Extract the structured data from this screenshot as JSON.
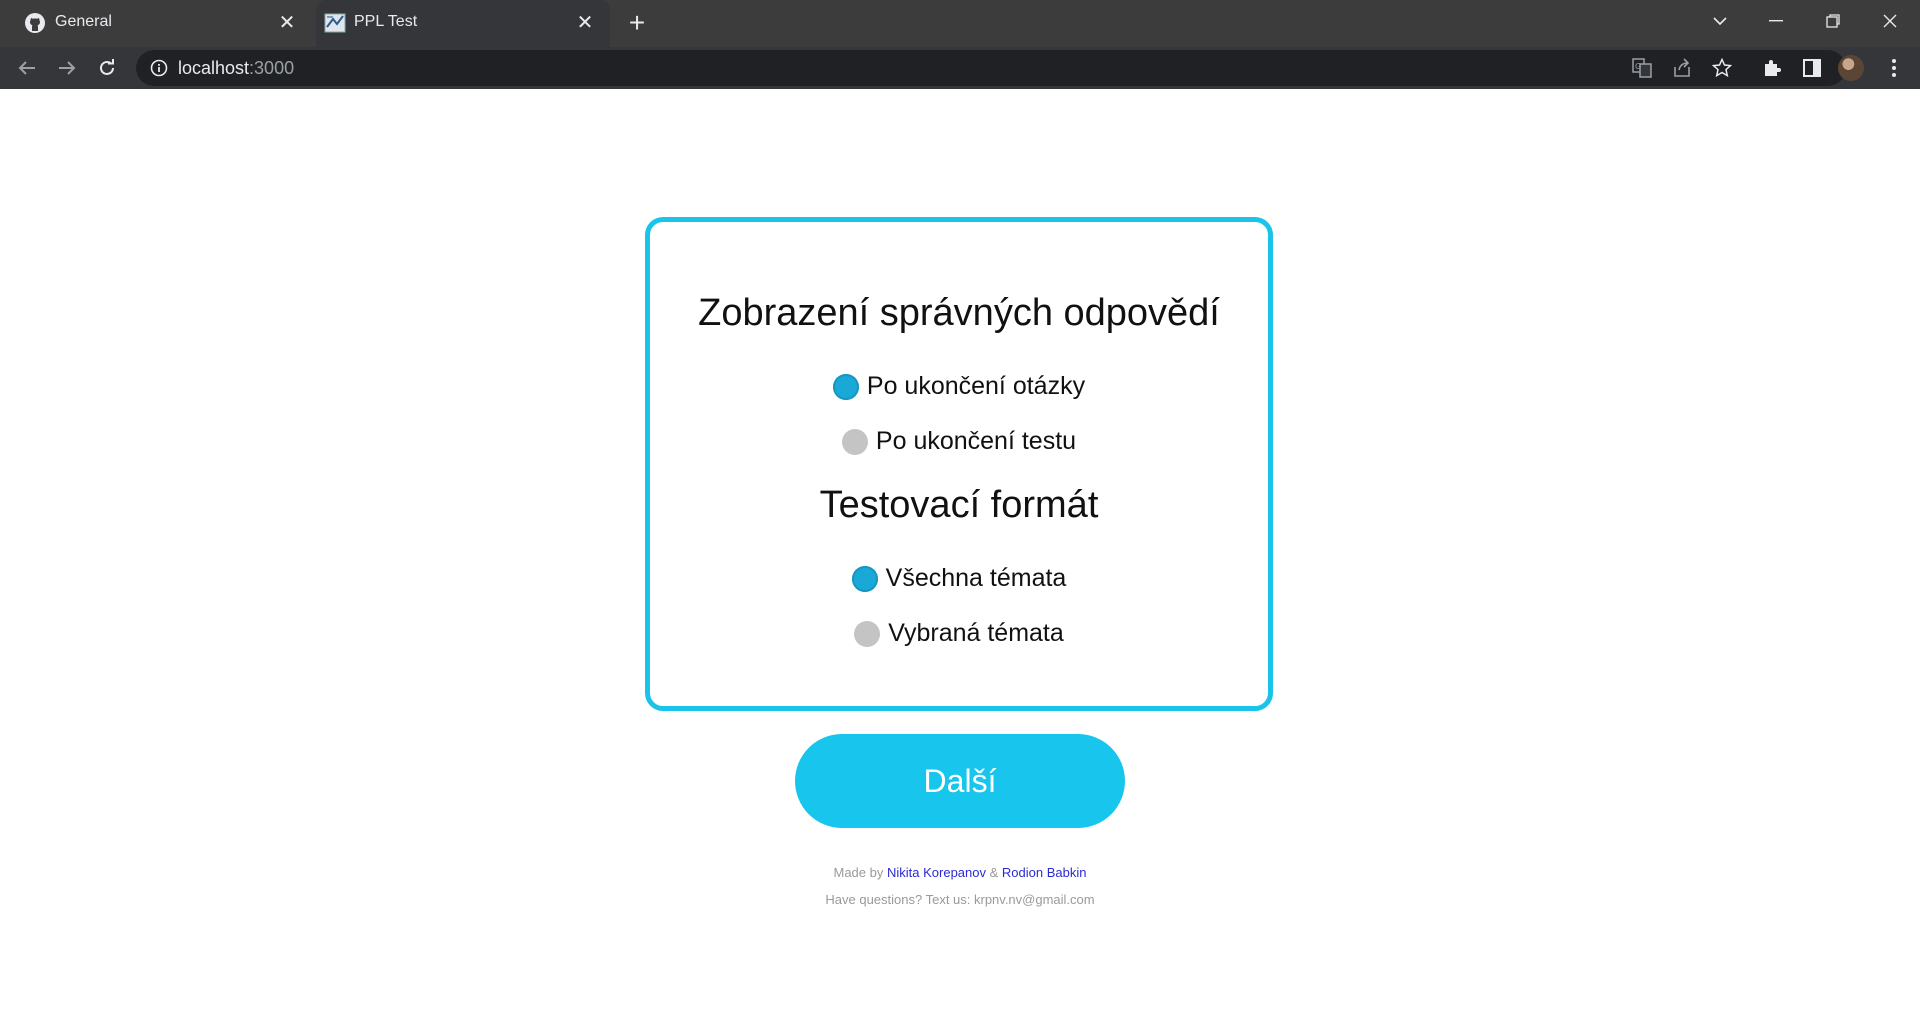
{
  "browser": {
    "tabs": [
      {
        "title": "General",
        "icon": "github-icon",
        "active": false
      },
      {
        "title": "PPL Test",
        "icon": "page-favicon",
        "active": true
      }
    ],
    "url_host": "localhost",
    "url_port": ":3000"
  },
  "settings": {
    "answers_title": "Zobrazení správných odpovědí",
    "answers_options": [
      {
        "label": "Po ukončení otázky",
        "selected": true
      },
      {
        "label": "Po ukončení testu",
        "selected": false
      }
    ],
    "format_title": "Testovací formát",
    "format_options": [
      {
        "label": "Všechna témata",
        "selected": true
      },
      {
        "label": "Vybraná témata",
        "selected": false
      }
    ]
  },
  "next_button_label": "Další",
  "footer": {
    "made_by": "Made by",
    "author1": "Nikita Korepanov",
    "amp": "&",
    "author2": "Rodion Babkin",
    "contact": "Have questions? Text us: krpnv.nv@gmail.com"
  },
  "colors": {
    "accent": "#18c5ec",
    "radio_selected": "#1aa9d6",
    "radio_unselected": "#c4c4c4",
    "link": "#2b2bd6"
  }
}
